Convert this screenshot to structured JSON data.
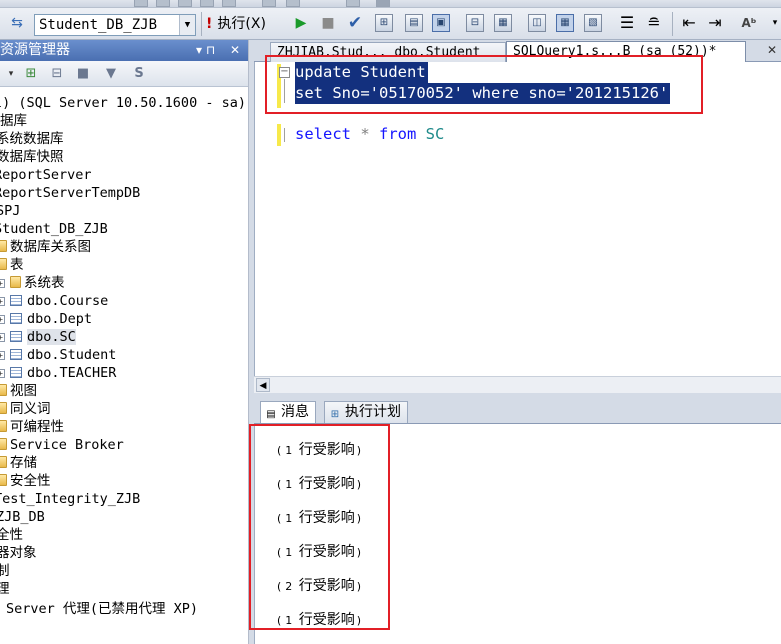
{
  "toolbar": {
    "database": "Student_DB_ZJB",
    "execute_label": "执行(X)"
  },
  "explorer": {
    "title": "资源管理器",
    "pin": "▾ ⊓",
    "close": "✕",
    "tree": [
      "l) (SQL Server 10.50.1600 - sa)",
      "据库",
      "系统数据库",
      "数据库快照",
      "ReportServer",
      "ReportServerTempDB",
      "SPJ",
      "Student_DB_ZJB",
      "数据库关系图",
      "表",
      "系统表",
      "dbo.Course",
      "dbo.Dept",
      "dbo.SC",
      "dbo.Student",
      "dbo.TEACHER",
      "视图",
      "同义词",
      "可编程性",
      "Service Broker",
      "存储",
      "安全性",
      "Test_Integrity_ZJB",
      "ZJB_DB",
      "全性",
      "器对象",
      "制",
      "理",
      "Server 代理(已禁用代理 XP)"
    ]
  },
  "tabs": [
    "ZHJIAB.Stud... dbo.Student",
    "SQLQuery1.s...B (sa (52))*"
  ],
  "tabs_close": "✕",
  "editor": {
    "line1": {
      "kw": "update",
      "rest": " Student"
    },
    "line2": {
      "kw1": "set",
      "a": " Sno=",
      "s1": "'05170052'",
      "kw2": " where",
      "b": " sno=",
      "s2": "'201215126'"
    },
    "line3": {
      "kw1": "select",
      "star": " *",
      "kw2": " from",
      "obj": " SC"
    }
  },
  "results": {
    "tab_messages": "消息",
    "tab_plan": "执行计划",
    "messages": [
      {
        "open": "(",
        "n": "1",
        "text": " 行受影响",
        "close": ")"
      },
      {
        "open": "(",
        "n": "1",
        "text": " 行受影响",
        "close": ")"
      },
      {
        "open": "(",
        "n": "1",
        "text": " 行受影响",
        "close": ")"
      },
      {
        "open": "(",
        "n": "1",
        "text": " 行受影响",
        "close": ")"
      },
      {
        "open": "(",
        "n": "2",
        "text": " 行受影响",
        "close": ")"
      },
      {
        "open": "(",
        "n": "1",
        "text": " 行受影响",
        "close": ")"
      }
    ]
  },
  "icons": {
    "execute": "exclamation-icon",
    "run": "play-icon",
    "stop": "stop-icon",
    "parse": "check-icon",
    "messages": "message-icon",
    "plan": "execution-plan-icon"
  },
  "colors": {
    "selection": "#13307e",
    "keyword": "#1515ff",
    "string": "#c41b1b",
    "annotation": "#e21f26",
    "explorer_title": "#5b80c0"
  }
}
